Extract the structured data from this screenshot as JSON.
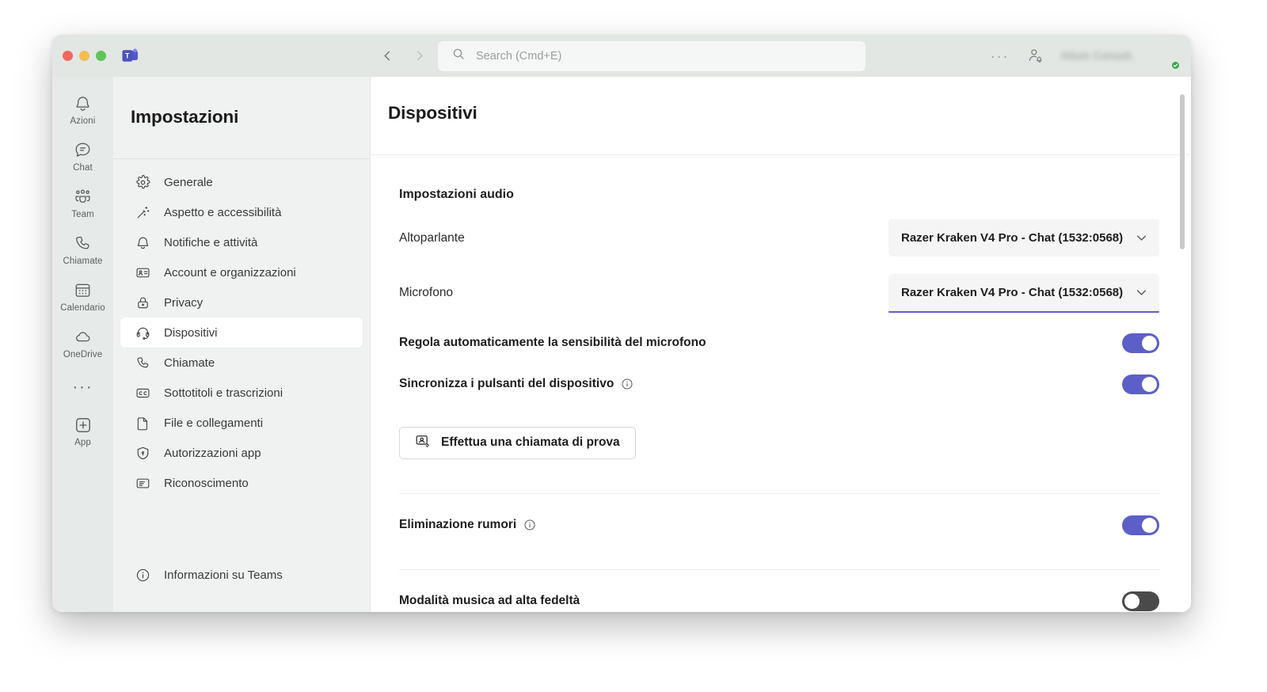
{
  "titlebar": {
    "search_placeholder": "Search (Cmd+E)",
    "more_label": "···",
    "username": "Altum Consult.",
    "back_icon": "chevron-left-icon",
    "forward_icon": "chevron-right-icon",
    "search_icon": "search-icon",
    "people_icon": "person-notify-icon",
    "status": "available"
  },
  "rail": {
    "items": [
      {
        "label": "Azioni",
        "icon": "bell-icon"
      },
      {
        "label": "Chat",
        "icon": "chat-icon"
      },
      {
        "label": "Team",
        "icon": "people-team-icon"
      },
      {
        "label": "Chiamate",
        "icon": "phone-icon"
      },
      {
        "label": "Calendario",
        "icon": "calendar-icon"
      },
      {
        "label": "OneDrive",
        "icon": "cloud-icon"
      }
    ],
    "more": "···",
    "app": {
      "label": "App",
      "icon": "plus-square-icon"
    }
  },
  "settings": {
    "title": "Impostazioni",
    "items": [
      {
        "label": "Generale",
        "icon": "gear-icon"
      },
      {
        "label": "Aspetto e accessibilità",
        "icon": "magic-wand-icon"
      },
      {
        "label": "Notifiche e attività",
        "icon": "bell-icon"
      },
      {
        "label": "Account e organizzazioni",
        "icon": "id-card-icon"
      },
      {
        "label": "Privacy",
        "icon": "lock-icon"
      },
      {
        "label": "Dispositivi",
        "icon": "headset-icon",
        "active": true
      },
      {
        "label": "Chiamate",
        "icon": "phone-icon"
      },
      {
        "label": "Sottotitoli e trascrizioni",
        "icon": "closed-caption-icon"
      },
      {
        "label": "File e collegamenti",
        "icon": "file-icon"
      },
      {
        "label": "Autorizzazioni app",
        "icon": "shield-icon"
      },
      {
        "label": "Riconoscimento",
        "icon": "praise-icon"
      }
    ],
    "about": {
      "label": "Informazioni su Teams",
      "icon": "info-circle-icon"
    }
  },
  "main": {
    "page_title": "Dispositivi",
    "audio_section_title": "Impostazioni audio",
    "speaker": {
      "label": "Altoparlante",
      "value": "Razer Kraken V4 Pro - Chat (1532:0568)",
      "chevron": "chevron-down-icon"
    },
    "microphone": {
      "label": "Microfono",
      "value": "Razer Kraken V4 Pro - Chat (1532:0568)",
      "chevron": "chevron-down-icon",
      "focused": true
    },
    "toggles": [
      {
        "label": "Regola automaticamente la sensibilità del microfono",
        "state": "on",
        "info": false
      },
      {
        "label": "Sincronizza i pulsanti del dispositivo",
        "state": "on",
        "info": true
      },
      {
        "label": "Eliminazione rumori",
        "state": "on",
        "info": true
      },
      {
        "label": "Modalità musica ad alta fedeltà",
        "state": "off",
        "info": false
      }
    ],
    "test_call_button": {
      "label": "Effettua una chiamata di prova",
      "icon": "test-call-icon"
    }
  },
  "colors": {
    "accent": "#5B5FC7",
    "toggle_on": "#5B5FC7",
    "toggle_off": "#4a4a4a",
    "window_chrome": "#E2E7E4",
    "rail_bg": "#E6EAE8",
    "nav_bg": "#F0F2F1",
    "content_bg": "#FFFFFF",
    "status_online": "#37A84A",
    "traffic_red": "#F2685F",
    "traffic_yellow": "#F5BC4F",
    "traffic_green": "#5FC558"
  }
}
